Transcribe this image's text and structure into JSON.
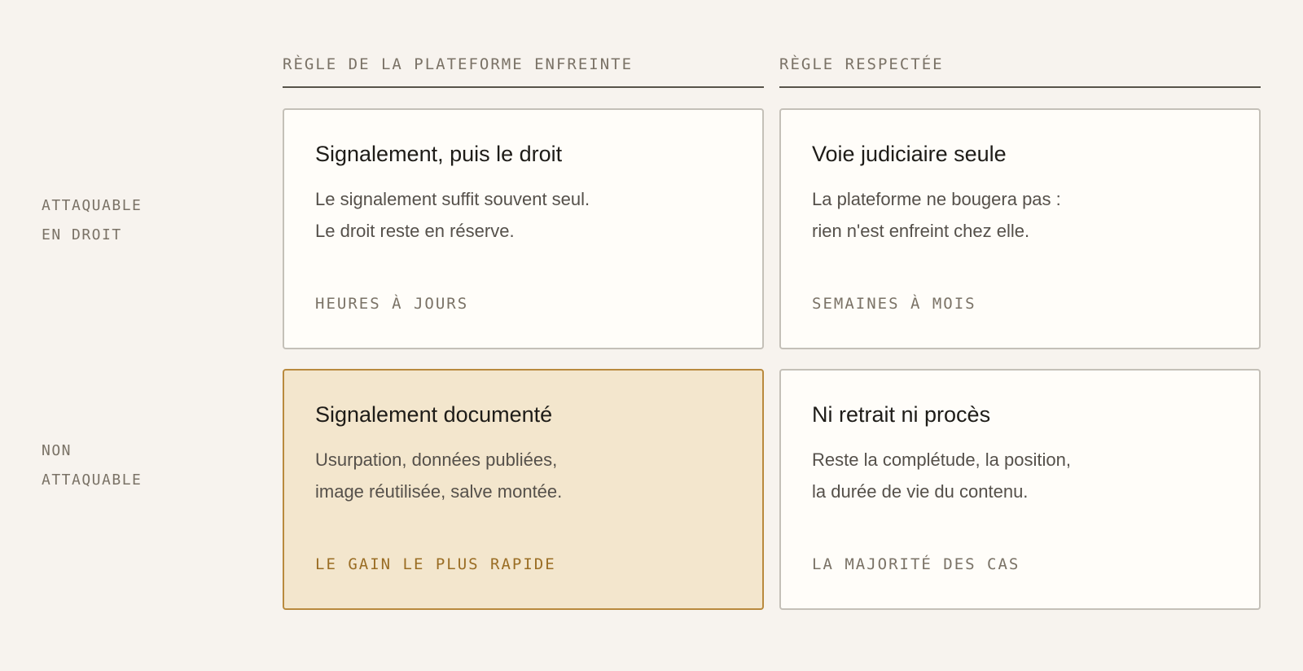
{
  "columns": [
    {
      "label": "RÈGLE DE LA PLATEFORME ENFREINTE"
    },
    {
      "label": "RÈGLE RESPECTÉE"
    }
  ],
  "rows": [
    {
      "label_lines": [
        "ATTAQUABLE",
        "EN DROIT"
      ]
    },
    {
      "label_lines": [
        "NON",
        "ATTAQUABLE"
      ]
    }
  ],
  "cells": [
    {
      "title": "Signalement, puis le droit",
      "body": [
        "Le signalement suffit souvent seul.",
        "Le droit reste en réserve."
      ],
      "tag": "HEURES À JOURS",
      "highlight": false
    },
    {
      "title": "Voie judiciaire seule",
      "body": [
        "La plateforme ne bougera pas :",
        "rien n'est enfreint chez elle."
      ],
      "tag": "SEMAINES À MOIS",
      "highlight": false
    },
    {
      "title": "Signalement documenté",
      "body": [
        "Usurpation, données publiées,",
        "image réutilisée, salve montée."
      ],
      "tag": "LE GAIN LE PLUS RAPIDE",
      "highlight": true
    },
    {
      "title": "Ni retrait ni procès",
      "body": [
        "Reste la complétude, la position,",
        "la durée de vie du contenu."
      ],
      "tag": "LA MAJORITÉ DES CAS",
      "highlight": false
    }
  ],
  "colors": {
    "background": "#f7f3ee",
    "card": "#fffdf9",
    "highlight_fill": "#f3e6cd",
    "highlight_border": "#b98a3e",
    "highlight_tag": "#9a6d24",
    "muted_text": "#7a7266"
  }
}
